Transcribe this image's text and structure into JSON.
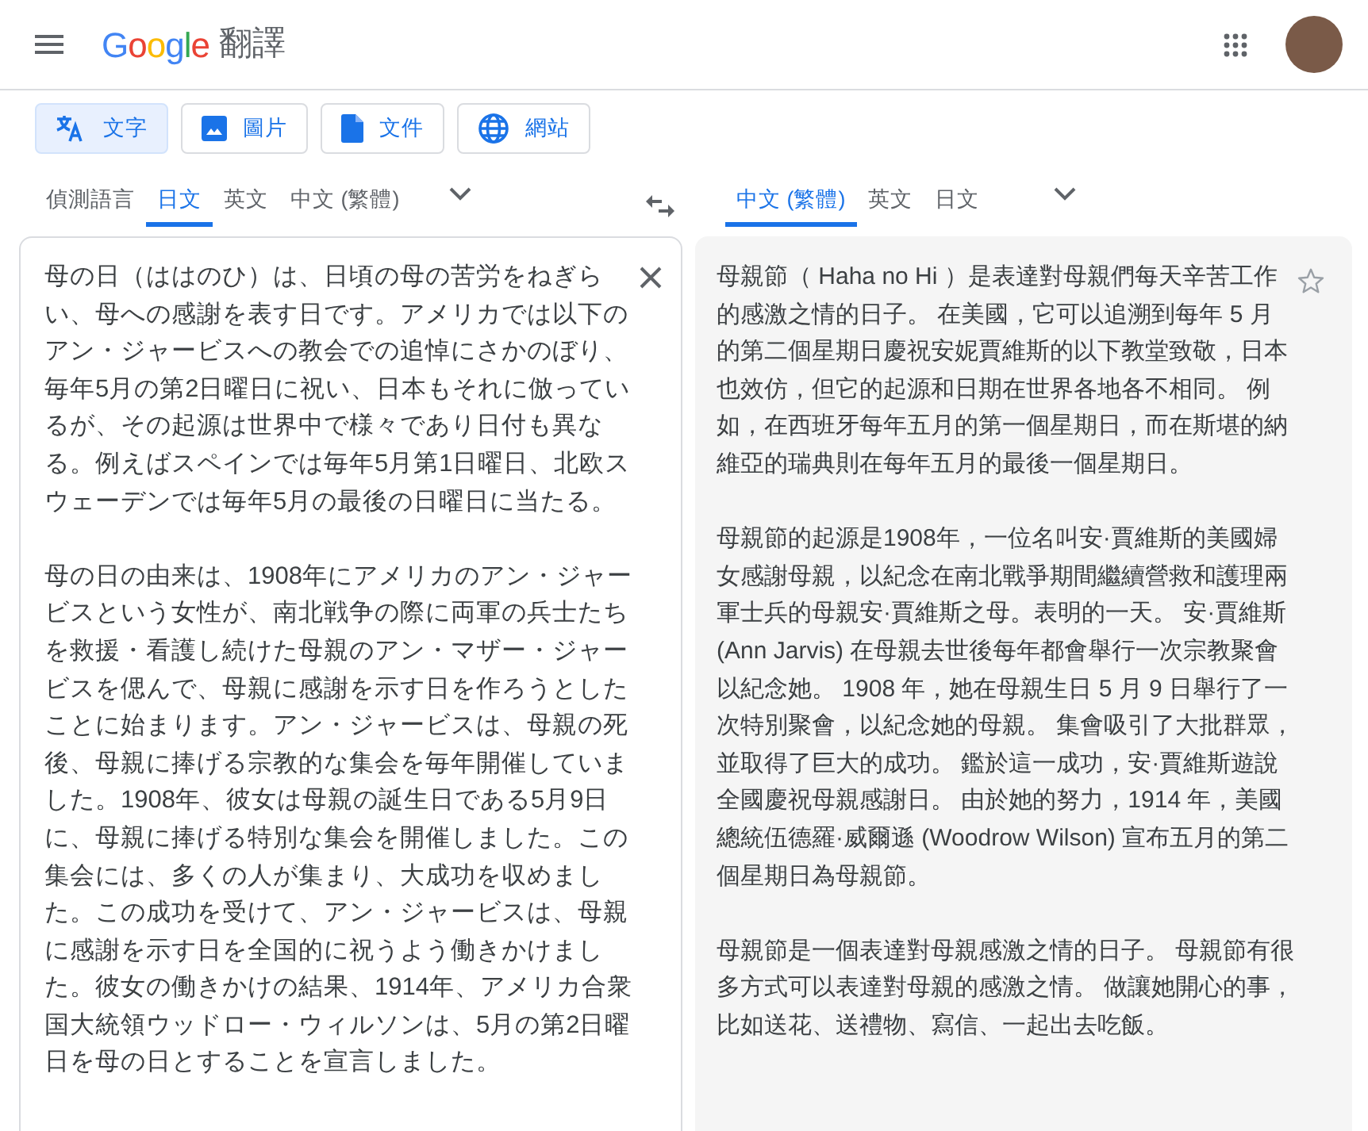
{
  "header": {
    "logo": "Google",
    "title": "翻譯"
  },
  "modes": [
    {
      "kind": "text",
      "label": "文字",
      "selected": true
    },
    {
      "kind": "image",
      "label": "圖片",
      "selected": false
    },
    {
      "kind": "document",
      "label": "文件",
      "selected": false
    },
    {
      "kind": "website",
      "label": "網站",
      "selected": false
    }
  ],
  "source_languages": [
    {
      "label": "偵測語言",
      "selected": false
    },
    {
      "label": "日文",
      "selected": true
    },
    {
      "label": "英文",
      "selected": false
    },
    {
      "label": "中文 (繁體)",
      "selected": false
    }
  ],
  "target_languages": [
    {
      "label": "中文 (繁體)",
      "selected": true
    },
    {
      "label": "英文",
      "selected": false
    },
    {
      "label": "日文",
      "selected": false
    }
  ],
  "source_text": {
    "paragraphs": [
      "母の日（ははのひ）は、日頃の母の苦労をねぎらい、母への感謝を表す日です。アメリカでは以下のアン・ジャービスへの教会での追悼にさかのぼり、毎年5月の第2日曜日に祝い、日本もそれに倣っているが、その起源は世界中で様々であり日付も異なる。例えばスペインでは毎年5月第1日曜日、北欧スウェーデンでは毎年5月の最後の日曜日に当たる。",
      "母の日の由来は、1908年にアメリカのアン・ジャービスという女性が、南北戦争の際に両軍の兵士たちを救援・看護し続けた母親のアン・マザー・ジャービスを偲んで、母親に感謝を示す日を作ろうとしたことに始まります。アン・ジャービスは、母親の死後、母親に捧げる宗教的な集会を毎年開催していました。1908年、彼女は母親の誕生日である5月9日に、母親に捧げる特別な集会を開催しました。この集会には、多くの人が集まり、大成功を収めました。この成功を受けて、アン・ジャービスは、母親に感謝を示す日を全国的に祝うよう働きかけました。彼女の働きかけの結果、1914年、アメリカ合衆国大統領ウッドロー・ウィルソンは、5月の第2日曜日を母の日とすることを宣言しました。"
    ]
  },
  "translation": {
    "paragraphs": [
      "母親節（ Haha no Hi ）是表達對母親們每天辛苦工作的感激之情的日子。 在美國，它可以追溯到每年 5 月的第二個星期日慶祝安妮賈維斯的以下教堂致敬，日本也效仿，但它的起源和日期在世界各地各不相同。 例如，在西班牙每年五月的第一個星期日，而在斯堪的納維亞的瑞典則在每年五月的最後一個星期日。",
      "母親節的起源是1908年，一位名叫安·賈維斯的美國婦女感謝母親，以紀念在南北戰爭期間繼續營救和護理兩軍士兵的母親安·賈維斯之母。表明的一天。 安·賈維斯 (Ann Jarvis) 在母親去世後每年都會舉行一次宗教聚會以紀念她。 1908 年，她在母親生日 5 月 9 日舉行了一次特別聚會，以紀念她的母親。 集會吸引了大批群眾，並取得了巨大的成功。 鑑於這一成功，安·賈維斯遊說全國慶祝母親感謝日。 由於她的努力，1914 年，美國總統伍德羅·威爾遜 (Woodrow Wilson) 宣布五月的第二個星期日為母親節。",
      "母親節是一個表達對母親感激之情的日子。 母親節有很多方式可以表達對母親的感激之情。 做讓她開心的事，比如送花、送禮物、寫信、一起出去吃飯。"
    ]
  }
}
